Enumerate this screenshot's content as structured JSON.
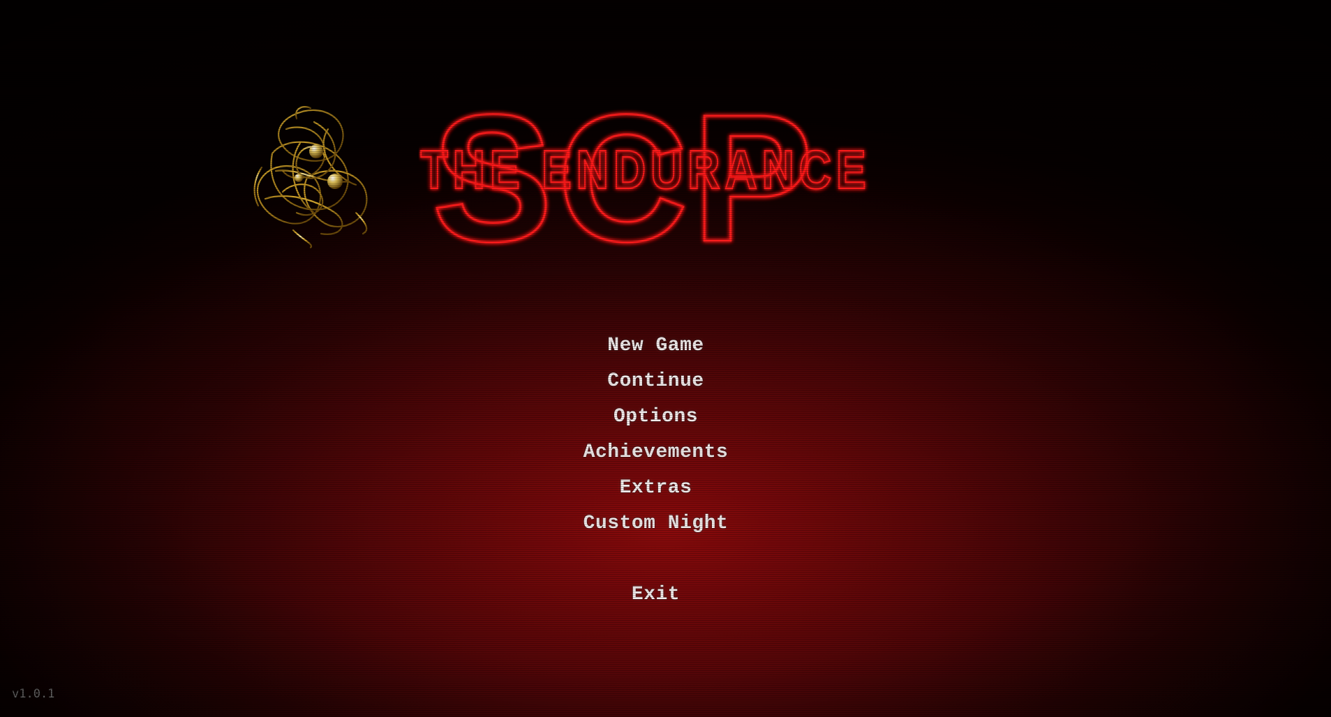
{
  "title_logo": {
    "big_text": "SCP",
    "subtitle": "THE ENDURANCE"
  },
  "menu": {
    "items": [
      {
        "label": "New Game"
      },
      {
        "label": "Continue"
      },
      {
        "label": "Options"
      },
      {
        "label": "Achievements"
      },
      {
        "label": "Extras"
      },
      {
        "label": "Custom Night"
      }
    ],
    "exit_label": "Exit"
  },
  "version": "v1.0.1",
  "colors": {
    "neon_red": "#ff1a1a",
    "menu_text": "#f3ecec",
    "background": "#5a0608",
    "wire_gold": "#d4a62a"
  },
  "icons": {
    "logo_art": "golden-wire-ball-icon"
  }
}
